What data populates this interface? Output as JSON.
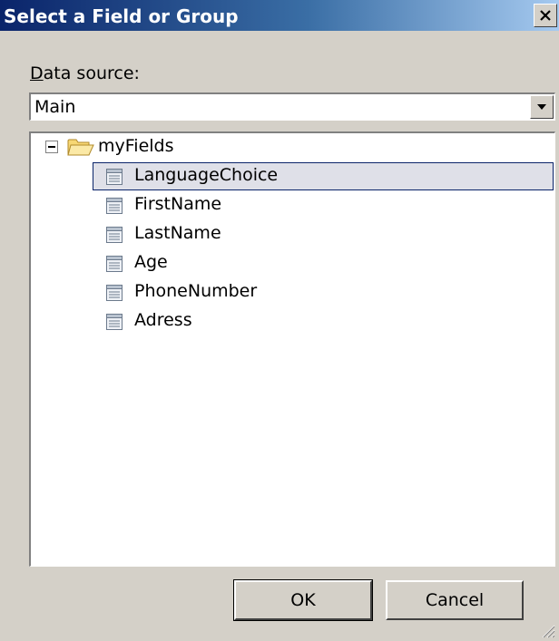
{
  "window": {
    "title": "Select a Field or Group",
    "close_icon": "close-icon"
  },
  "data_source": {
    "label_mnemonic": "D",
    "label_rest": "ata source:",
    "selected": "Main"
  },
  "tree": {
    "root": {
      "label": "myFields",
      "icon": "folder-open-icon",
      "expanded": true
    },
    "items": [
      {
        "label": "LanguageChoice",
        "icon": "field-icon",
        "selected": true
      },
      {
        "label": "FirstName",
        "icon": "field-icon"
      },
      {
        "label": "LastName",
        "icon": "field-icon"
      },
      {
        "label": "Age",
        "icon": "field-icon"
      },
      {
        "label": "PhoneNumber",
        "icon": "field-icon"
      },
      {
        "label": "Adress",
        "icon": "field-icon"
      }
    ]
  },
  "buttons": {
    "ok": "OK",
    "cancel": "Cancel"
  },
  "colors": {
    "title_bar_start": "#0a246a",
    "title_bar_end": "#a6caf0",
    "dialog_face": "#d4d0c8",
    "selection_border": "#0a246a"
  }
}
